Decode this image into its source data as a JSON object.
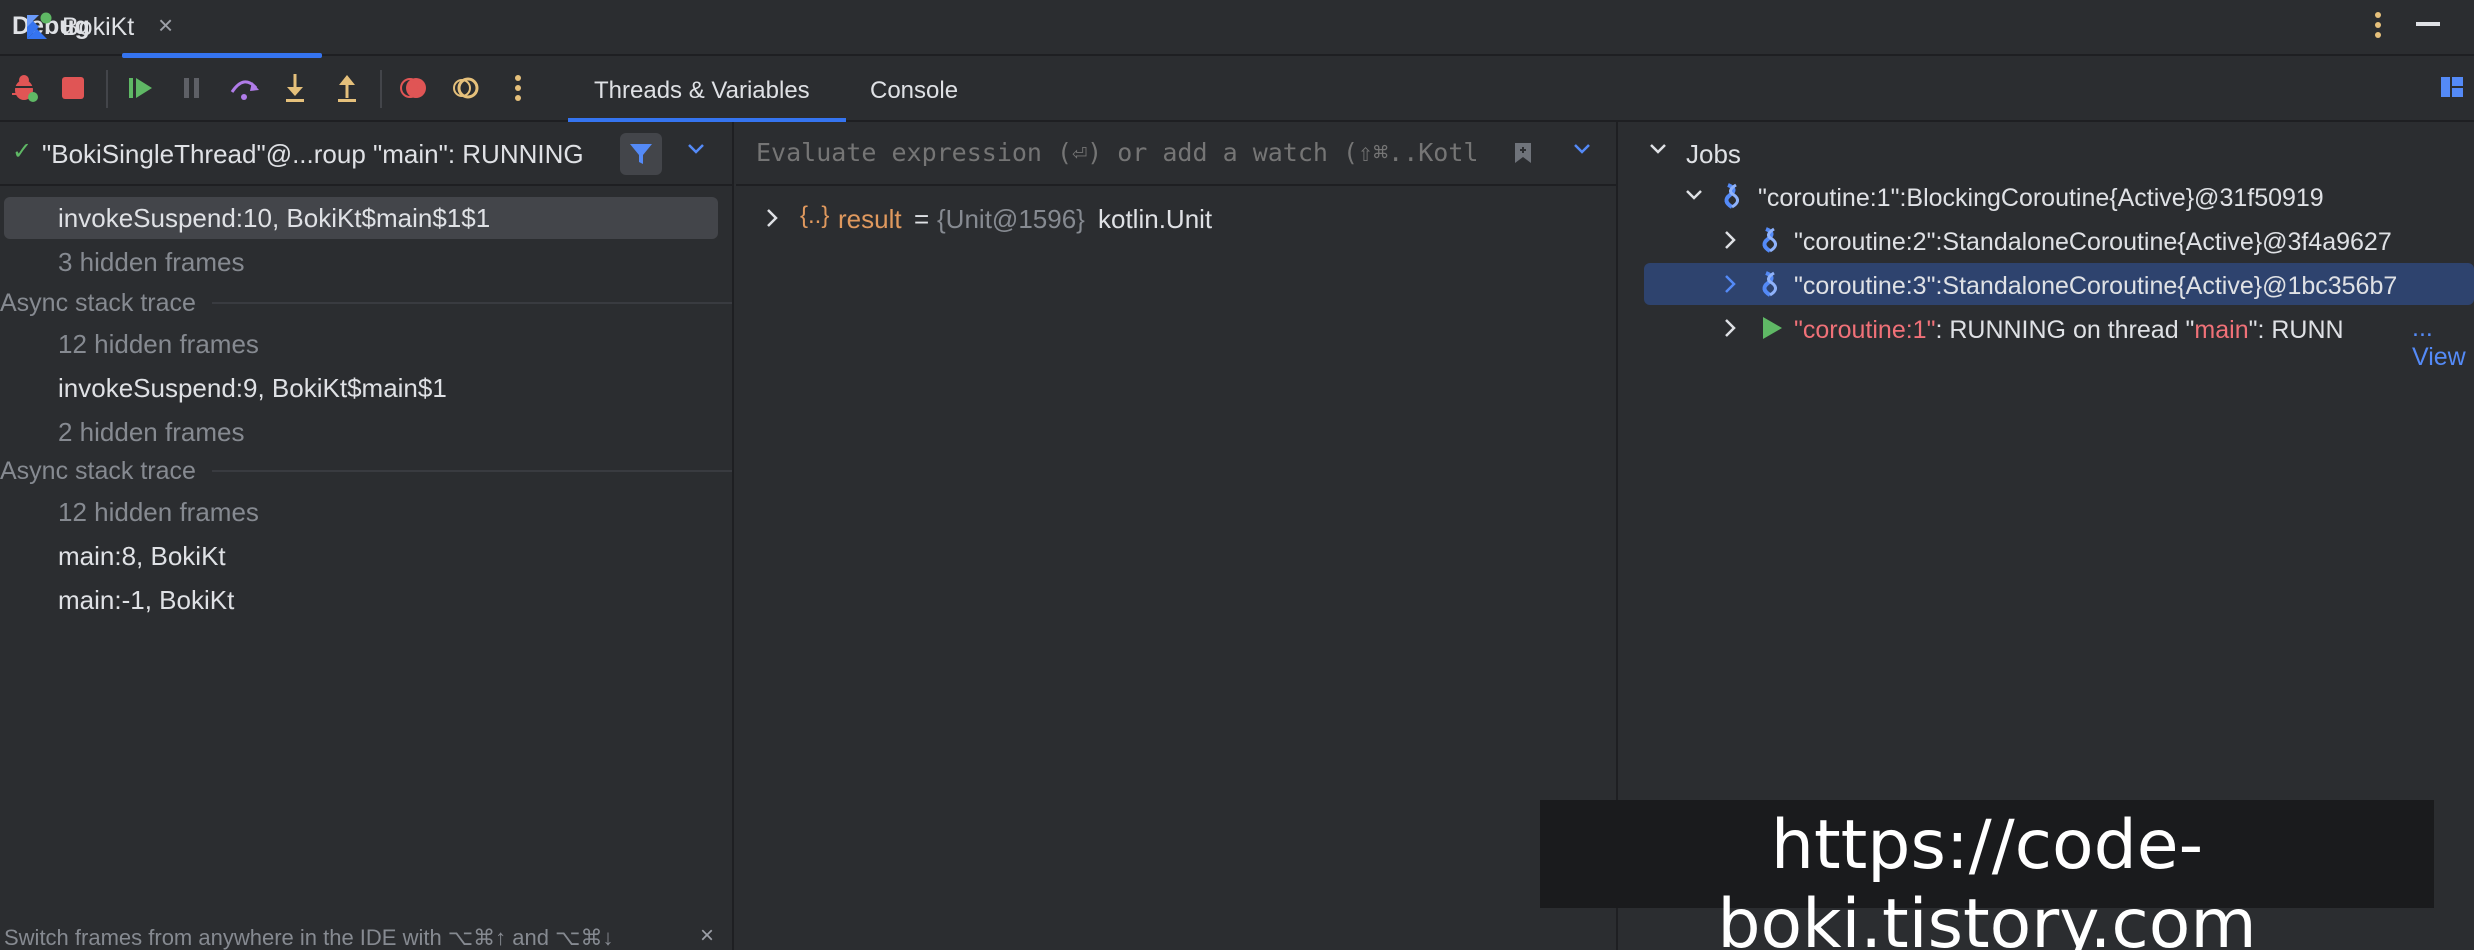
{
  "window": {
    "title": "Debug",
    "tab_label": "BokiKt",
    "tab_close": "×"
  },
  "toolbar": {
    "tabs": [
      {
        "label": "Threads & Variables",
        "active": true
      },
      {
        "label": "Console",
        "active": false
      }
    ]
  },
  "threads": {
    "selected_thread": "\"BokiSingleThread\"@...roup \"main\": RUNNING",
    "frames": [
      {
        "text": "invokeSuspend:10, BokiKt$main$1$1",
        "kind": "frame",
        "selected": true
      },
      {
        "text": "3 hidden frames",
        "kind": "hidden"
      },
      {
        "text": "Async stack trace",
        "kind": "async"
      },
      {
        "text": "12 hidden frames",
        "kind": "hidden"
      },
      {
        "text": "invokeSuspend:9, BokiKt$main$1",
        "kind": "frame"
      },
      {
        "text": "2 hidden frames",
        "kind": "hidden"
      },
      {
        "text": "Async stack trace",
        "kind": "async"
      },
      {
        "text": "12 hidden frames",
        "kind": "hidden"
      },
      {
        "text": "main:8, BokiKt",
        "kind": "frame"
      },
      {
        "text": "main:-1, BokiKt",
        "kind": "frame"
      }
    ],
    "hint": "Switch frames from anywhere in the IDE with ⌥⌘↑ and ⌥⌘↓",
    "hint_close": "×"
  },
  "variables": {
    "eval_placeholder": "Evaluate expression (⏎) or add a watch (⇧⌘..Kotlin",
    "rows": [
      {
        "icon": "{..}",
        "name": "result",
        "eq": "=",
        "ref": "{Unit@1596}",
        "value": "kotlin.Unit"
      }
    ]
  },
  "jobs": {
    "title": "Jobs",
    "rows": [
      {
        "text": "\"coroutine:1\":BlockingCoroutine{Active}@31f50919"
      },
      {
        "text": "\"coroutine:2\":StandaloneCoroutine{Active}@3f4a9627"
      },
      {
        "text": "\"coroutine:3\":StandaloneCoroutine{Active}@1bc356b7",
        "selected": true
      },
      {
        "part1": "\"coroutine:1\"",
        "part2": ": RUNNING on thread \"",
        "part3": "main",
        "part4": "\": RUNN",
        "link": "... View"
      }
    ]
  },
  "watermark": "https://code-boki.tistory.com",
  "colors": {
    "background": "#2b2d30",
    "accent": "#3574f0",
    "selection": "#2e436e",
    "running_red": "#f07178",
    "link": "#548af7"
  }
}
